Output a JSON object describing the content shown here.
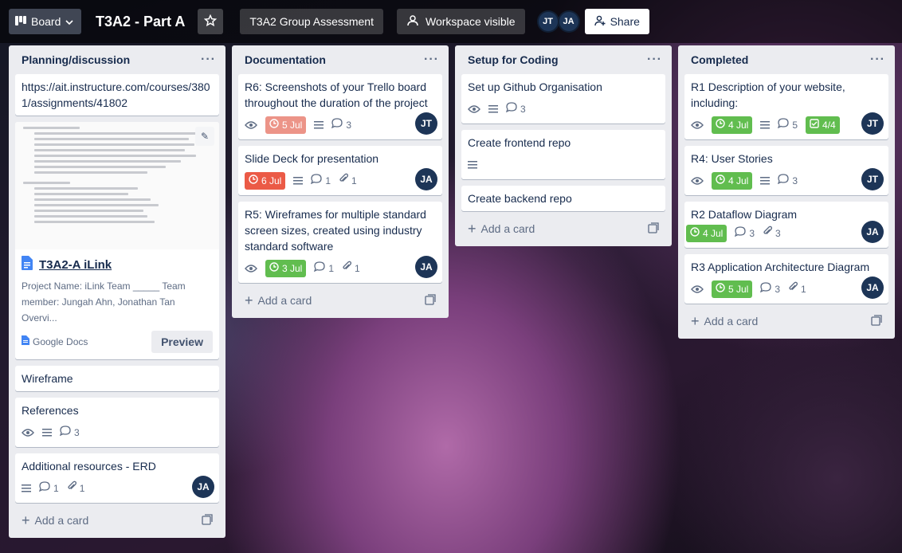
{
  "header": {
    "board_btn": "Board",
    "title": "T3A2 - Part A",
    "workspace": "T3A2 Group Assessment",
    "visibility": "Workspace visible",
    "share": "Share",
    "members": [
      "JT",
      "JA"
    ]
  },
  "lists": [
    {
      "title": "Planning/discussion",
      "link_card": "https://ait.instructure.com/courses/3801/assignments/41802",
      "doc_card": {
        "title": "T3A2-A iLink",
        "desc": "Project Name: iLink Team _____ Team member: Jungah Ahn, Jonathan Tan Overvi...",
        "source": "Google Docs",
        "preview": "Preview"
      },
      "cards": [
        {
          "title": "Wireframe"
        },
        {
          "title": "References",
          "comments": "3"
        },
        {
          "title": "Additional resources - ERD",
          "comments": "1",
          "attachments": "1",
          "member": "JA"
        }
      ],
      "add": "Add a card"
    },
    {
      "title": "Documentation",
      "cards": [
        {
          "title": "R6: Screenshots of your Trello board throughout the duration of the project",
          "due": "5 Jul",
          "comments": "3",
          "member": "JT"
        },
        {
          "title": "Slide Deck for presentation",
          "due": "6 Jul",
          "comments": "1",
          "attachments": "1",
          "member": "JA"
        },
        {
          "title": "R5: Wireframes for multiple standard screen sizes, created using industry standard software",
          "due": "3 Jul",
          "comments": "1",
          "attachments": "1",
          "member": "JA"
        }
      ],
      "add": "Add a card"
    },
    {
      "title": "Setup for Coding",
      "cards": [
        {
          "title": "Set up Github Organisation",
          "comments": "3"
        },
        {
          "title": "Create frontend repo"
        },
        {
          "title": "Create backend repo"
        }
      ],
      "add": "Add a card"
    },
    {
      "title": "Completed",
      "cards": [
        {
          "title": "R1 Description of your website, including:",
          "due": "4 Jul",
          "comments": "5",
          "checklist": "4/4",
          "member": "JT"
        },
        {
          "title": "R4: User Stories",
          "due": "4 Jul",
          "comments": "3",
          "member": "JT"
        },
        {
          "title": "R2 Dataflow Diagram",
          "due": "4 Jul",
          "comments": "3",
          "attachments": "3",
          "member": "JA"
        },
        {
          "title": "R3 Application Architecture Diagram",
          "due": "5 Jul",
          "comments": "3",
          "attachments": "1",
          "member": "JA"
        }
      ],
      "add": "Add a card"
    }
  ]
}
